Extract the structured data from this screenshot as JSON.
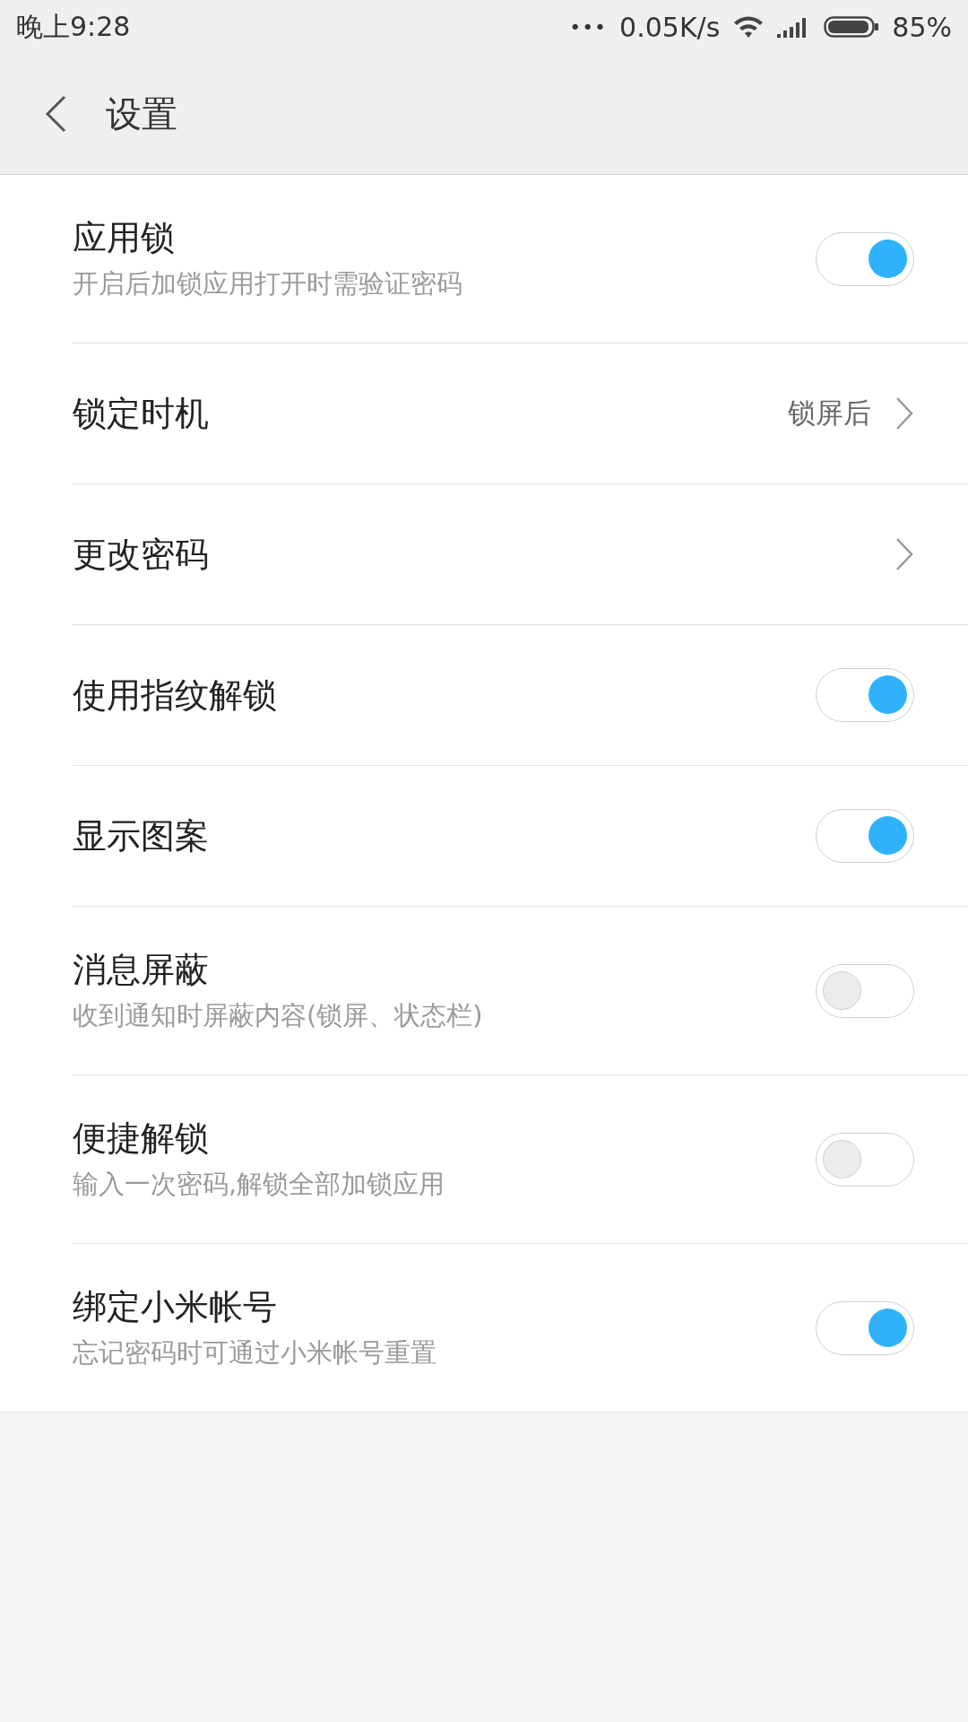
{
  "status_bar": {
    "time": "晚上9:28",
    "more": "•••",
    "speed": "0.05K/s",
    "battery": "85%"
  },
  "header": {
    "title": "设置"
  },
  "items": [
    {
      "kind": "toggle",
      "title": "应用锁",
      "subtitle": "开启后加锁应用打开时需验证密码",
      "on": true
    },
    {
      "kind": "link",
      "title": "锁定时机",
      "value": "锁屏后"
    },
    {
      "kind": "link",
      "title": "更改密码"
    },
    {
      "kind": "toggle",
      "title": "使用指纹解锁",
      "on": true
    },
    {
      "kind": "toggle",
      "title": "显示图案",
      "on": true
    },
    {
      "kind": "toggle",
      "title": "消息屏蔽",
      "subtitle": "收到通知时屏蔽内容(锁屏、状态栏)",
      "on": false
    },
    {
      "kind": "toggle",
      "title": "便捷解锁",
      "subtitle": "输入一次密码,解锁全部加锁应用",
      "on": false
    },
    {
      "kind": "toggle",
      "title": "绑定小米帐号",
      "subtitle": "忘记密码时可通过小米帐号重置",
      "on": true
    }
  ]
}
